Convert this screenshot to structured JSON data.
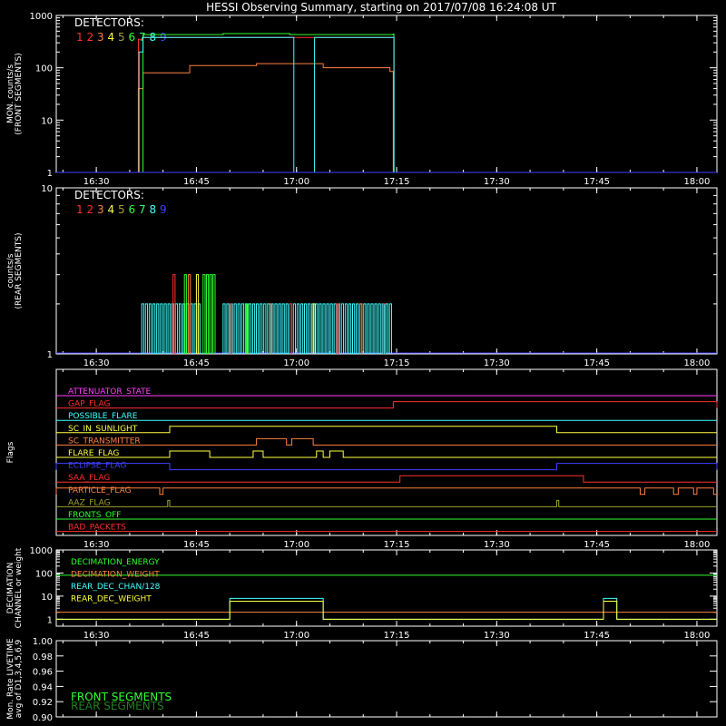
{
  "title": "HESSI Observing Summary, starting on 2017/07/08 16:24:08 UT",
  "time_axis": {
    "ticks": [
      "16:30",
      "16:45",
      "17:00",
      "17:15",
      "17:30",
      "17:45",
      "18:00"
    ],
    "range_minutes": [
      0,
      99
    ]
  },
  "colors": {
    "det1": "#ff3030",
    "det2": "#ff3030",
    "det3": "#ff8040",
    "det4": "#ffff40",
    "det5": "#a0a030",
    "det6": "#30ff30",
    "det7": "#30ff80",
    "det8": "#40ffff",
    "det9": "#4040ff"
  },
  "chart_data": [
    {
      "type": "line",
      "ylabel": [
        "MON. counts/s",
        "(FRONT SEGMENTS)"
      ],
      "yscale": "log",
      "ylim": [
        1,
        1000
      ],
      "yticks": [
        "1",
        "10",
        "100",
        "1000"
      ],
      "legend_title": "DETECTORS:",
      "legend_items": [
        "1",
        "2",
        "3",
        "4",
        "5",
        "6",
        "7",
        "8",
        "9"
      ],
      "series": [
        {
          "name": "1",
          "color": "#ff3030",
          "x": [
            0,
            12.2,
            12.3,
            13.0,
            50.5,
            50.6,
            99
          ],
          "y": [
            1,
            1,
            350,
            380,
            380,
            1,
            1
          ]
        },
        {
          "name": "3",
          "color": "#ff8040",
          "x": [
            0,
            12.2,
            12.3,
            13.0,
            20,
            30,
            40,
            50.0,
            50.5,
            99
          ],
          "y": [
            1,
            1,
            40,
            80,
            110,
            120,
            100,
            85,
            1,
            1
          ]
        },
        {
          "name": "6",
          "color": "#30ff30",
          "x": [
            0,
            12.3,
            13.0,
            25,
            35,
            50.5,
            50.6,
            99
          ],
          "y": [
            1,
            1,
            430,
            450,
            430,
            440,
            1,
            1
          ]
        },
        {
          "name": "8",
          "color": "#40ffff",
          "x": [
            0,
            12.3,
            12.4,
            13.0,
            35.5,
            35.6,
            38.6,
            38.7,
            50.5,
            50.6,
            99
          ],
          "y": [
            1,
            1,
            200,
            380,
            380,
            1,
            1,
            380,
            380,
            1,
            1
          ]
        },
        {
          "name": "9",
          "color": "#4040ff",
          "x": [
            0,
            99
          ],
          "y": [
            1,
            1
          ]
        }
      ]
    },
    {
      "type": "bar",
      "ylabel": [
        "counts/s",
        "(REAR SEGMENTS)"
      ],
      "yscale": "log",
      "ylim": [
        1,
        10
      ],
      "yticks": [
        "1",
        "10"
      ],
      "legend_title": "DETECTORS:",
      "legend_items": [
        "1",
        "2",
        "3",
        "4",
        "5",
        "6",
        "7",
        "8",
        "9"
      ],
      "pulses": [
        {
          "x": 12.8,
          "w": 9,
          "y": 2,
          "color": "#40ffff"
        },
        {
          "x": 17.5,
          "w": 0.6,
          "y": 3,
          "color": "#ff3030"
        },
        {
          "x": 19.2,
          "w": 0.6,
          "y": 3,
          "color": "#30ff30"
        },
        {
          "x": 19.8,
          "w": 0.5,
          "y": 3,
          "color": "#ff8040"
        },
        {
          "x": 21.0,
          "w": 0.5,
          "y": 3,
          "color": "#ffff40"
        },
        {
          "x": 22.0,
          "w": 2.0,
          "y": 3,
          "color": "#30ff30"
        },
        {
          "x": 25.0,
          "w": 25.5,
          "y": 2,
          "color": "#40ffff"
        },
        {
          "x": 26.0,
          "w": 0.5,
          "y": 2,
          "color": "#ff3030"
        },
        {
          "x": 28.5,
          "w": 0.5,
          "y": 2,
          "color": "#30ff30"
        },
        {
          "x": 32.0,
          "w": 0.5,
          "y": 2,
          "color": "#ff8040"
        },
        {
          "x": 35.0,
          "w": 0.5,
          "y": 2,
          "color": "#ff3030"
        },
        {
          "x": 38.5,
          "w": 0.5,
          "y": 2,
          "color": "#ffff40"
        },
        {
          "x": 42.0,
          "w": 0.5,
          "y": 2,
          "color": "#ff3030"
        },
        {
          "x": 45.5,
          "w": 0.5,
          "y": 2,
          "color": "#ff8040"
        },
        {
          "x": 49.0,
          "w": 0.5,
          "y": 2,
          "color": "#ff3030"
        }
      ]
    },
    {
      "type": "line",
      "ylabel": [
        "Flags"
      ],
      "flags": [
        {
          "name": "ATTENUATOR_STATE",
          "color": "#ff40ff",
          "segments": [
            [
              0,
              0
            ]
          ]
        },
        {
          "name": "GAP_FLAG",
          "color": "#ff3030",
          "segments": [
            [
              50.5,
              99
            ]
          ]
        },
        {
          "name": "POSSIBLE_FLARE",
          "color": "#40ffff",
          "segments": []
        },
        {
          "name": "SC_IN_SUNLIGHT",
          "color": "#ffff40",
          "segments": [
            [
              17,
              75
            ]
          ]
        },
        {
          "name": "SC_TRANSMITTER",
          "color": "#ff8040",
          "segments": [
            [
              30,
              34.5
            ],
            [
              35.3,
              38.5
            ]
          ]
        },
        {
          "name": "FLARE_FLAG",
          "color": "#ffff40",
          "segments": [
            [
              17,
              23
            ],
            [
              29.5,
              31
            ],
            [
              39,
              40
            ],
            [
              41,
              43
            ]
          ]
        },
        {
          "name": "ECLIPSE_FLAG",
          "color": "#4040ff",
          "segments": [
            [
              0,
              17
            ],
            [
              75,
              99
            ]
          ]
        },
        {
          "name": "SAA_FLAG",
          "color": "#ff3030",
          "segments": [
            [
              51.5,
              79
            ]
          ]
        },
        {
          "name": "PARTICLE_FLAG",
          "color": "#ff8040",
          "segments": [
            [
              0,
              15.5
            ],
            [
              16,
              87.5
            ],
            [
              88.2,
              92.5
            ],
            [
              93.2,
              95.5
            ],
            [
              96,
              98.5
            ]
          ]
        },
        {
          "name": "AAZ_FLAG",
          "color": "#a0a030",
          "segments": [
            [
              16.7,
              17
            ],
            [
              75,
              75.3
            ]
          ]
        },
        {
          "name": "FRONTS_OFF",
          "color": "#30ff30",
          "segments": []
        },
        {
          "name": "BAD_PACKETS",
          "color": "#ff3030",
          "segments": []
        }
      ]
    },
    {
      "type": "line",
      "ylabel": [
        "DECIMATION",
        "CHANNEL or weight"
      ],
      "yscale": "log",
      "ylim": [
        0.5,
        1000
      ],
      "yticks": [
        "1",
        "10",
        "100",
        "1000"
      ],
      "series": [
        {
          "name": "DECIMATION_ENERGY",
          "color": "#30ff30",
          "x": [
            0,
            99
          ],
          "y": [
            80,
            80
          ]
        },
        {
          "name": "DECIMATION_WEIGHT",
          "color": "#ff8040",
          "x": [
            0,
            99
          ],
          "y": [
            2,
            2
          ]
        },
        {
          "name": "REAR_DEC_CHAN/128",
          "color": "#40ffff",
          "x": [
            0,
            25.9,
            26,
            39.9,
            40,
            81.9,
            82,
            83.9,
            84,
            99
          ],
          "y": [
            1,
            1,
            8,
            8,
            1,
            1,
            8,
            8,
            1,
            1
          ]
        },
        {
          "name": "REAR_DEC_WEIGHT",
          "color": "#ffff40",
          "x": [
            0,
            25.9,
            26,
            39.9,
            40,
            81.9,
            82,
            83.9,
            84,
            99
          ],
          "y": [
            1,
            1,
            6,
            6,
            1,
            1,
            6,
            6,
            1,
            1
          ]
        }
      ]
    },
    {
      "type": "line",
      "ylabel": [
        "Mon. Rate LIVETIME",
        "avg of D1,3,4,5,6,9"
      ],
      "ylim": [
        0.9,
        1.0
      ],
      "yticks": [
        "0.90",
        "0.92",
        "0.94",
        "0.96",
        "0.98",
        "1.00"
      ],
      "series": [
        {
          "name": "FRONT SEGMENTS",
          "color": "#30ff30"
        },
        {
          "name": "REAR SEGMENTS",
          "color": "#208020"
        }
      ]
    }
  ]
}
